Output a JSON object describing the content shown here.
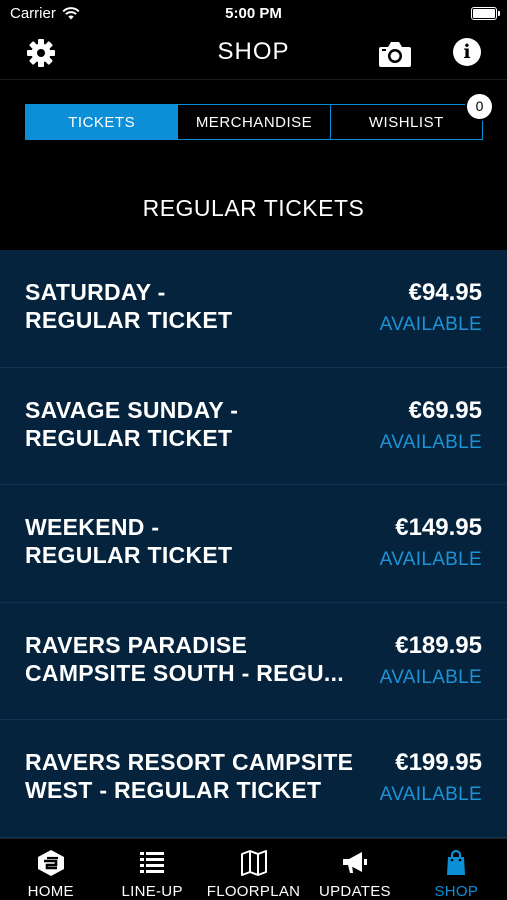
{
  "status_bar": {
    "carrier": "Carrier",
    "time": "5:00 PM"
  },
  "header": {
    "title": "SHOP"
  },
  "tabs": [
    {
      "label": "TICKETS",
      "active": true
    },
    {
      "label": "MERCHANDISE",
      "active": false
    },
    {
      "label": "WISHLIST",
      "active": false
    }
  ],
  "wishlist_count": "0",
  "section_title": "REGULAR TICKETS",
  "tickets": [
    {
      "line1": "SATURDAY -",
      "line2": "REGULAR TICKET",
      "price": "€94.95",
      "status": "AVAILABLE"
    },
    {
      "line1": "SAVAGE SUNDAY -",
      "line2": "REGULAR TICKET",
      "price": "€69.95",
      "status": "AVAILABLE"
    },
    {
      "line1": "WEEKEND -",
      "line2": "REGULAR TICKET",
      "price": "€149.95",
      "status": "AVAILABLE"
    },
    {
      "line1": "RAVERS PARADISE",
      "line2": "CAMPSITE SOUTH - REGU...",
      "price": "€189.95",
      "status": "AVAILABLE"
    },
    {
      "line1": "RAVERS RESORT CAMPSITE",
      "line2": "WEST - REGULAR TICKET",
      "price": "€199.95",
      "status": "AVAILABLE"
    }
  ],
  "tab_bar": [
    {
      "label": "HOME",
      "icon": "home-logo-icon",
      "active": false
    },
    {
      "label": "LINE-UP",
      "icon": "list-icon",
      "active": false
    },
    {
      "label": "FLOORPLAN",
      "icon": "map-icon",
      "active": false
    },
    {
      "label": "UPDATES",
      "icon": "megaphone-icon",
      "active": false
    },
    {
      "label": "SHOP",
      "icon": "shopping-bag-icon",
      "active": true
    }
  ],
  "colors": {
    "accent": "#0d8fd8",
    "list_bg": "#05233c",
    "available": "#1d93d6",
    "background": "#000000"
  }
}
